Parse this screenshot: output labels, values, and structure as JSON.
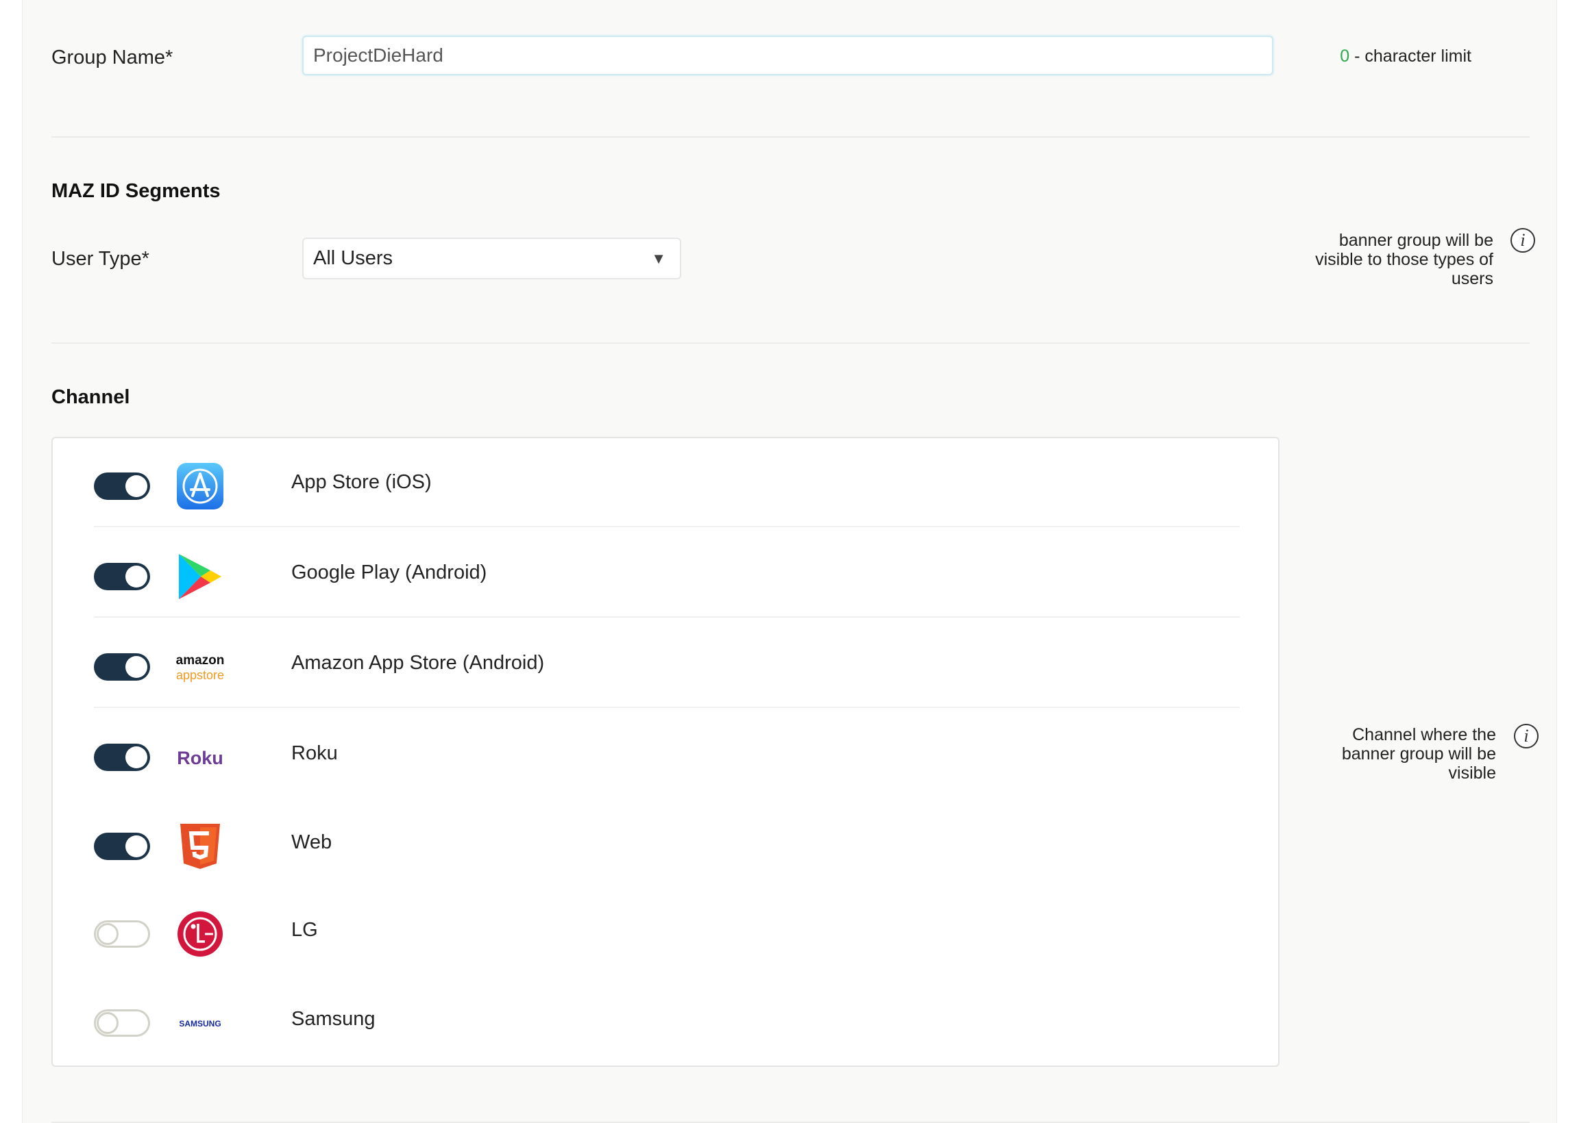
{
  "group_name": {
    "label": "Group Name*",
    "value": "ProjectDieHard",
    "char_count": "0",
    "char_limit_text": " - character limit"
  },
  "segments": {
    "heading": "MAZ ID Segments",
    "user_type_label": "User Type*",
    "user_type_value": "All Users",
    "hint_lines": [
      "banner group will be",
      "visible to those types of",
      "users"
    ]
  },
  "channel": {
    "heading": "Channel",
    "hint_lines": [
      "Channel where the",
      "banner group will be",
      "visible"
    ],
    "items": [
      {
        "name": "App Store (iOS)",
        "enabled": true,
        "icon": "app-store-icon"
      },
      {
        "name": "Google Play (Android)",
        "enabled": true,
        "icon": "google-play-icon"
      },
      {
        "name": "Amazon App Store (Android)",
        "enabled": true,
        "icon": "amazon-appstore-icon",
        "logo_line1": "amazon",
        "logo_line2": "appstore"
      },
      {
        "name": "Roku",
        "enabled": true,
        "icon": "roku-icon",
        "logo_text": "Roku"
      },
      {
        "name": "Web",
        "enabled": true,
        "icon": "html5-icon"
      },
      {
        "name": "LG",
        "enabled": false,
        "icon": "lg-icon"
      },
      {
        "name": "Samsung",
        "enabled": false,
        "icon": "samsung-icon",
        "logo_text": "SAMSUNG"
      }
    ]
  },
  "colors": {
    "toggle_on": "#1d3347",
    "toggle_off_border": "#d2d1c8",
    "char_count": "#2eaa4d",
    "roku": "#6c3c97",
    "samsung": "#1428a0",
    "amazon_orange": "#f29a21",
    "lg_red": "#d3163c",
    "html5_orange": "#e44d26"
  }
}
